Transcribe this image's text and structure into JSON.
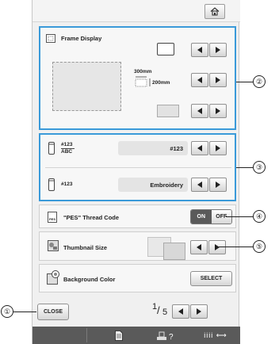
{
  "frame_display": {
    "label": "Frame Display",
    "size_top": "300mm",
    "size_side": "200mm"
  },
  "thread_number": {
    "label_top": "#123",
    "label_bottom": "ABC",
    "value": "#123"
  },
  "thread_brand": {
    "label": "#123",
    "value": "Embroidery"
  },
  "pes_thread": {
    "label": "\"PES\" Thread Code",
    "icon_text": "PES",
    "on": "ON",
    "off": "OFF"
  },
  "thumbnail": {
    "label": "Thumbnail Size"
  },
  "background": {
    "label": "Background Color",
    "button": "SELECT"
  },
  "footer": {
    "close": "CLOSE",
    "page_current": "1",
    "page_total": "5",
    "bottom_icon_3": "iiii ⟷"
  },
  "callouts": [
    "①",
    "②",
    "③",
    "④",
    "⑤"
  ]
}
